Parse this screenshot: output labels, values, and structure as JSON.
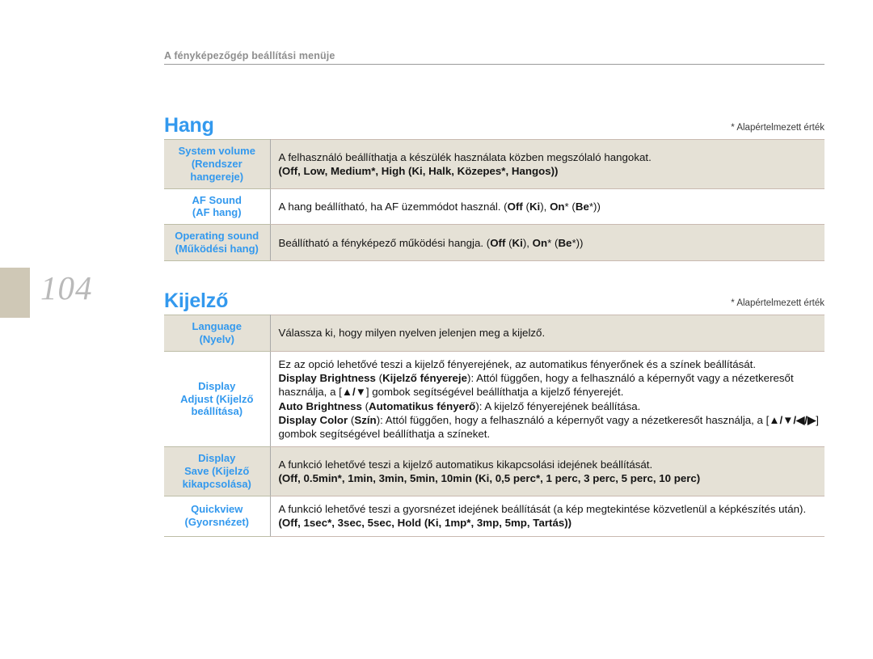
{
  "header": {
    "running_title": "A fényképezőgép beállítási menüje"
  },
  "page": {
    "number": "104"
  },
  "sections": [
    {
      "id": "sound",
      "title": "Hang",
      "note": "* Alapértelmezett érték",
      "rows": [
        {
          "label_en": "System volume",
          "label_hu_1": "(Rendszer",
          "label_hu_2": "hangereje)",
          "lines": [
            "A felhasználó beállíthatja a készülék használata közben megszólaló hangokat.",
            "(Off, Low, Medium*, High (Ki, Halk, Közepes*, Hangos))"
          ]
        },
        {
          "label_en": "AF Sound",
          "label_hu_1": "(AF hang)",
          "lines": [
            "A hang beállítható, ha AF üzemmódot használ. (Off (Ki), On* (Be*))"
          ]
        },
        {
          "label_en": "Operating sound",
          "label_hu_1": "(Működési hang)",
          "lines": [
            "Beállítható a fényképező működési hangja. (Off (Ki), On* (Be*))"
          ]
        }
      ]
    },
    {
      "id": "display",
      "title": "Kijelző",
      "note": "* Alapértelmezett érték",
      "rows": [
        {
          "label_en": "Language",
          "label_hu_1": "(Nyelv)",
          "lines": [
            "Válassza ki, hogy milyen nyelven jelenjen meg a kijelző."
          ]
        },
        {
          "label_en": "Display",
          "label_hu_1": "Adjust (Kijelző",
          "label_hu_2": "beállítása)",
          "lines": [
            "Ez az opció lehetővé teszi a kijelző fényerejének, az automatikus fényerőnek és a színek beállítását.",
            "Display Brightness (Kijelző fényereje): Attól függően, hogy a felhasználó a képernyőt vagy a nézetkeresőt használja, a [▲/▼] gombok segítségével beállíthatja a kijelző fényerejét.",
            "Auto Brightness (Automatikus fényerő): A kijelző fényerejének beállítása.",
            "Display Color (Szín): Attól függően, hogy a felhasználó a képernyőt vagy a nézetkeresőt használja, a [▲/▼/◀/▶] gombok segítségével beállíthatja a színeket."
          ]
        },
        {
          "label_en": "Display",
          "label_hu_1": "Save (Kijelző",
          "label_hu_2": "kikapcsolása)",
          "lines": [
            "A funkció lehetővé teszi a kijelző automatikus kikapcsolási idejének beállítását.",
            "(Off, 0.5min*, 1min, 3min, 5min, 10min (Ki, 0,5 perc*, 1 perc, 3 perc, 5 perc, 10 perc)"
          ]
        },
        {
          "label_en": "Quickview",
          "label_hu_1": "(Gyorsnézet)",
          "lines": [
            "A funkció lehetővé teszi a gyorsnézet idejének beállítását (a kép megtekintése közvetlenül a képkészítés után).",
            "(Off, 1sec*, 3sec, 5sec, Hold (Ki, 1mp*, 3mp, 5mp, Tartás))"
          ]
        }
      ]
    }
  ],
  "colors": {
    "accent_blue": "#3399ee",
    "tint_row": "#e5e1d6",
    "page_block": "#cfc8b6",
    "page_number": "#b9b9b9",
    "header_gray": "#8e8e8e"
  }
}
